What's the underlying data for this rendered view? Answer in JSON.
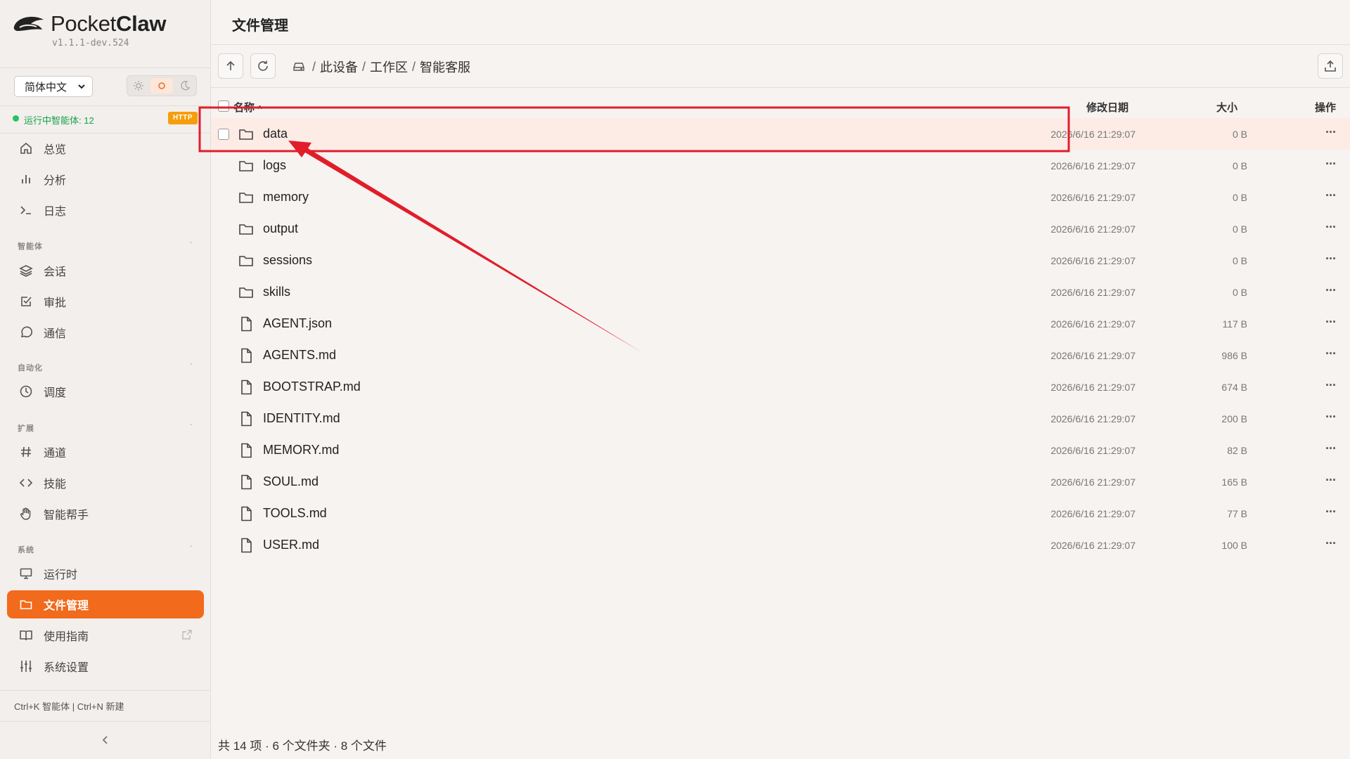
{
  "brand": {
    "name_light": "Pocket",
    "name_bold": "Claw",
    "version": "v1.1.1-dev.524"
  },
  "sidebar": {
    "language": "简体中文",
    "theme": {
      "options": [
        "light-icon",
        "system-icon",
        "dark-icon"
      ],
      "active": "system-icon"
    },
    "status_text": "运行中智能体: 12",
    "protocol_badge": "HTTP",
    "top_items": [
      {
        "label": "总览",
        "icon": "home-icon"
      },
      {
        "label": "分析",
        "icon": "bar-chart-icon"
      },
      {
        "label": "日志",
        "icon": "terminal-icon"
      }
    ],
    "sections": [
      {
        "label": "智能体",
        "toggle": "-",
        "items": [
          {
            "label": "会话",
            "icon": "layers-icon"
          },
          {
            "label": "审批",
            "icon": "check-square-icon"
          },
          {
            "label": "通信",
            "icon": "message-circle-icon"
          }
        ]
      },
      {
        "label": "自动化",
        "toggle": "-",
        "items": [
          {
            "label": "调度",
            "icon": "clock-icon"
          }
        ]
      },
      {
        "label": "扩展",
        "toggle": "-",
        "items": [
          {
            "label": "通道",
            "icon": "hash-icon"
          },
          {
            "label": "技能",
            "icon": "code-icon"
          },
          {
            "label": "智能帮手",
            "icon": "hand-icon"
          }
        ]
      },
      {
        "label": "系统",
        "toggle": "-",
        "items": [
          {
            "label": "运行时",
            "icon": "monitor-icon"
          },
          {
            "label": "文件管理",
            "icon": "folder-icon",
            "active": true
          },
          {
            "label": "使用指南",
            "icon": "book-icon",
            "external": true
          },
          {
            "label": "系统设置",
            "icon": "sliders-icon"
          }
        ]
      }
    ],
    "shortcut_hint": "Ctrl+K 智能体 | Ctrl+N 新建"
  },
  "main": {
    "title": "文件管理",
    "breadcrumb": [
      "此设备",
      "工作区",
      "智能客服"
    ],
    "columns": {
      "name": "名称",
      "sort_indicator": "^",
      "date": "修改日期",
      "size": "大小",
      "actions": "操作"
    },
    "files": [
      {
        "name": "data",
        "type": "folder",
        "date": "2026/6/16 21:29:07",
        "size": "0 B",
        "highlighted": true
      },
      {
        "name": "logs",
        "type": "folder",
        "date": "2026/6/16 21:29:07",
        "size": "0 B"
      },
      {
        "name": "memory",
        "type": "folder",
        "date": "2026/6/16 21:29:07",
        "size": "0 B"
      },
      {
        "name": "output",
        "type": "folder",
        "date": "2026/6/16 21:29:07",
        "size": "0 B"
      },
      {
        "name": "sessions",
        "type": "folder",
        "date": "2026/6/16 21:29:07",
        "size": "0 B"
      },
      {
        "name": "skills",
        "type": "folder",
        "date": "2026/6/16 21:29:07",
        "size": "0 B"
      },
      {
        "name": "AGENT.json",
        "type": "file",
        "date": "2026/6/16 21:29:07",
        "size": "117 B"
      },
      {
        "name": "AGENTS.md",
        "type": "file",
        "date": "2026/6/16 21:29:07",
        "size": "986 B"
      },
      {
        "name": "BOOTSTRAP.md",
        "type": "file",
        "date": "2026/6/16 21:29:07",
        "size": "674 B"
      },
      {
        "name": "IDENTITY.md",
        "type": "file",
        "date": "2026/6/16 21:29:07",
        "size": "200 B"
      },
      {
        "name": "MEMORY.md",
        "type": "file",
        "date": "2026/6/16 21:29:07",
        "size": "82 B"
      },
      {
        "name": "SOUL.md",
        "type": "file",
        "date": "2026/6/16 21:29:07",
        "size": "165 B"
      },
      {
        "name": "TOOLS.md",
        "type": "file",
        "date": "2026/6/16 21:29:07",
        "size": "77 B"
      },
      {
        "name": "USER.md",
        "type": "file",
        "date": "2026/6/16 21:29:07",
        "size": "100 B"
      }
    ],
    "more_glyph": "···",
    "footer": "共 14 项 · 6 个文件夹 · 8 个文件"
  },
  "colors": {
    "accent": "#f26a1b",
    "status_green": "#16a34a",
    "badge": "#f59e0b",
    "annotation_red": "#e11d2a"
  }
}
